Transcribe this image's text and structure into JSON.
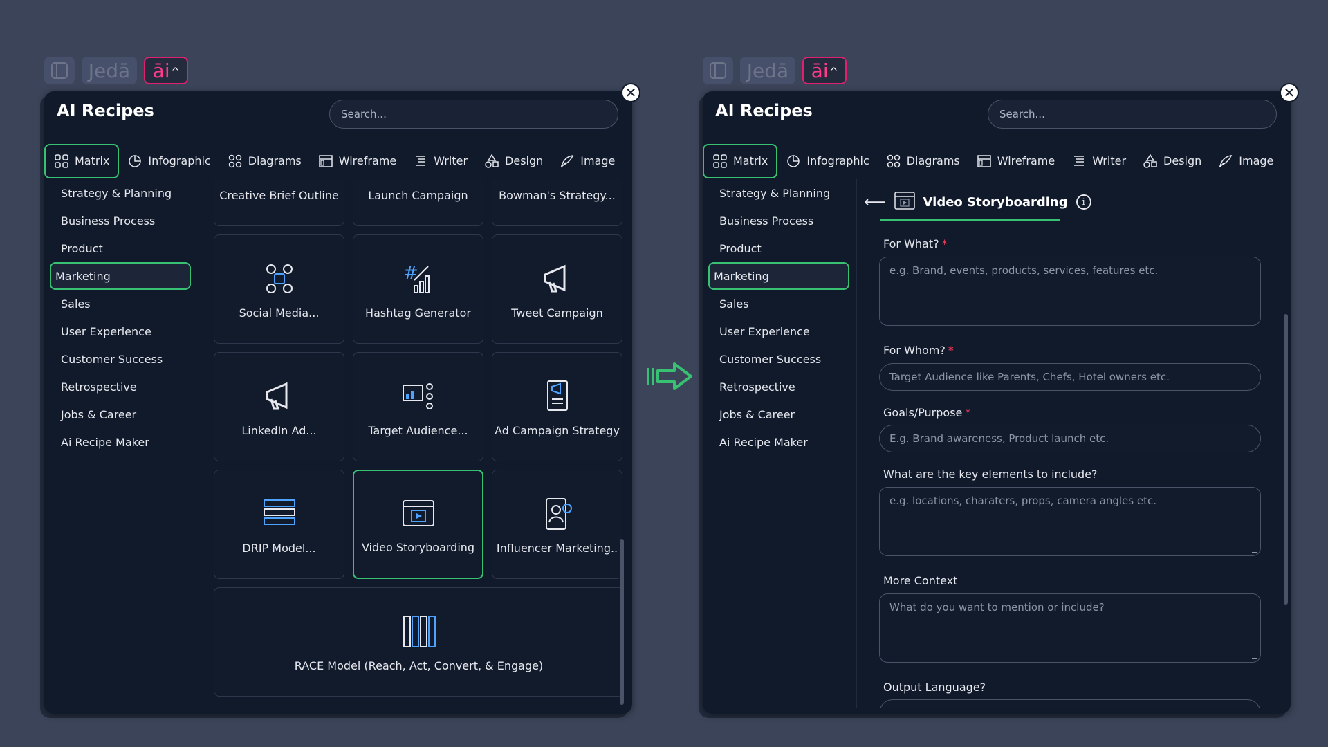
{
  "topbar": {
    "jeda_label": "Jedā",
    "ai_label": "āi",
    "caret": "^"
  },
  "panel": {
    "title": "AI Recipes",
    "search_placeholder": "Search...",
    "close": "✕"
  },
  "tabs": [
    {
      "label": "Matrix",
      "icon": "grid-icon"
    },
    {
      "label": "Infographic",
      "icon": "pie-icon"
    },
    {
      "label": "Diagrams",
      "icon": "nodes-icon"
    },
    {
      "label": "Wireframe",
      "icon": "wireframe-icon"
    },
    {
      "label": "Writer",
      "icon": "lines-icon"
    },
    {
      "label": "Design",
      "icon": "shapes-icon"
    },
    {
      "label": "Image",
      "icon": "image-pen-icon"
    }
  ],
  "categories": [
    "Strategy & Planning",
    "Business Process",
    "Product",
    "Marketing",
    "Sales",
    "User Experience",
    "Customer Success",
    "Retrospective",
    "Jobs & Career",
    "Ai Recipe Maker"
  ],
  "active_category": "Marketing",
  "cards": [
    {
      "label": "Creative Brief Outline",
      "icon": "doc-icon"
    },
    {
      "label": "Launch Campaign",
      "icon": "rocket-icon"
    },
    {
      "label": "Bowman's Strategy...",
      "icon": "compass-icon"
    },
    {
      "label": "Social Media...",
      "icon": "social-icon"
    },
    {
      "label": "Hashtag Generator",
      "icon": "hashtag-icon"
    },
    {
      "label": "Tweet Campaign",
      "icon": "megaphone-icon"
    },
    {
      "label": "LinkedIn Ad...",
      "icon": "megaphone-icon"
    },
    {
      "label": "Target Audience...",
      "icon": "audience-icon"
    },
    {
      "label": "Ad Campaign Strategy",
      "icon": "ad-doc-icon"
    },
    {
      "label": "DRIP Model...",
      "icon": "stack-icon"
    },
    {
      "label": "Video Storyboarding",
      "icon": "video-icon"
    },
    {
      "label": "Influencer Marketing..",
      "icon": "influencer-icon"
    },
    {
      "label": "RACE Model (Reach, Act, Convert, & Engage)",
      "icon": "columns-icon"
    }
  ],
  "form": {
    "back": "⟵",
    "title": "Video Storyboarding",
    "info": "i",
    "fields": [
      {
        "label": "For What?",
        "required": "*",
        "placeholder": "e.g. Brand, events, products, services, features etc."
      },
      {
        "label": "For Whom?",
        "required": "*",
        "placeholder": "Target Audience like Parents, Chefs, Hotel owners etc."
      },
      {
        "label": "Goals/Purpose",
        "required": "*",
        "placeholder": "E.g. Brand awareness, Product launch etc."
      },
      {
        "label": "What are the key elements to include?",
        "required": "",
        "placeholder": "e.g. locations, charaters, props, camera angles etc."
      },
      {
        "label": "More Context",
        "required": "",
        "placeholder": "What do you want to mention or include?"
      },
      {
        "label": "Output Language?",
        "required": "",
        "placeholder": ""
      }
    ]
  },
  "colors": {
    "accent": "#38c172",
    "brand": "#e0206f",
    "panel_bg": "#111a2b",
    "page_bg": "#3b4459"
  }
}
